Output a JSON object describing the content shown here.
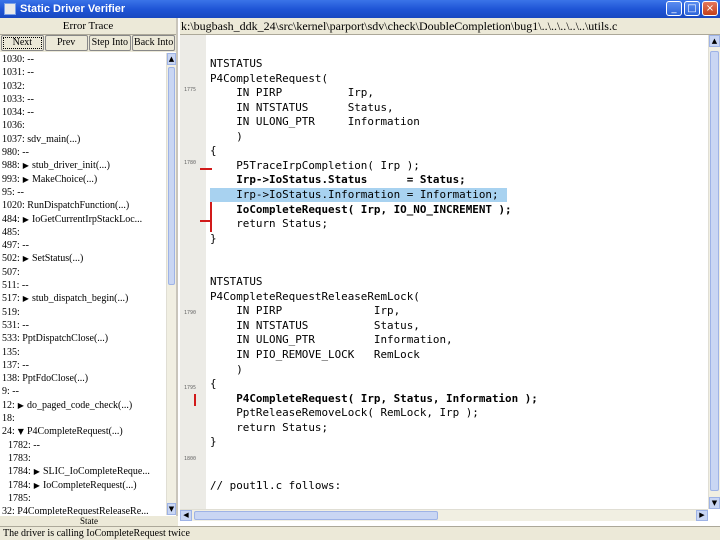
{
  "window": {
    "title": "Static Driver Verifier",
    "buttons": [
      "_",
      "□",
      "×"
    ]
  },
  "trace": {
    "header": "Error Trace",
    "buttons": [
      "Next",
      "Prev",
      "Step Into",
      "Back Into"
    ],
    "items": [
      {
        "text": "1030: --",
        "indent": 0,
        "arrow": ""
      },
      {
        "text": "1031: --",
        "indent": 0,
        "arrow": ""
      },
      {
        "text": "1032:",
        "indent": 0,
        "arrow": ""
      },
      {
        "text": "1033: --",
        "indent": 0,
        "arrow": ""
      },
      {
        "text": "1034: --",
        "indent": 0,
        "arrow": ""
      },
      {
        "text": "1036:",
        "indent": 0,
        "arrow": ""
      },
      {
        "text": "1037: sdv_main(...)",
        "indent": 0,
        "arrow": ""
      },
      {
        "text": "980: --",
        "indent": 0,
        "arrow": ""
      },
      {
        "text": "988:",
        "indent": 0,
        "arrow": "right",
        "call": "stub_driver_init(...)"
      },
      {
        "text": "993:",
        "indent": 0,
        "arrow": "right",
        "call": "MakeChoice(...)"
      },
      {
        "text": "95: --",
        "indent": 0,
        "arrow": ""
      },
      {
        "text": "1020: RunDispatchFunction(...)",
        "indent": 0,
        "arrow": ""
      },
      {
        "text": "484:",
        "indent": 0,
        "arrow": "right",
        "call": "IoGetCurrentIrpStackLoc..."
      },
      {
        "text": "485:",
        "indent": 0,
        "arrow": ""
      },
      {
        "text": "497: --",
        "indent": 0,
        "arrow": ""
      },
      {
        "text": "502:",
        "indent": 0,
        "arrow": "right",
        "call": "SetStatus(...)"
      },
      {
        "text": "507:",
        "indent": 0,
        "arrow": ""
      },
      {
        "text": "511: --",
        "indent": 0,
        "arrow": ""
      },
      {
        "text": "517:",
        "indent": 0,
        "arrow": "right",
        "call": "stub_dispatch_begin(...)"
      },
      {
        "text": "519:",
        "indent": 0,
        "arrow": ""
      },
      {
        "text": "531: --",
        "indent": 0,
        "arrow": ""
      },
      {
        "text": "533: PptDispatchClose(...)",
        "indent": 0,
        "arrow": ""
      },
      {
        "text": "135:",
        "indent": 0,
        "arrow": ""
      },
      {
        "text": "137: --",
        "indent": 0,
        "arrow": ""
      },
      {
        "text": "138: PptFdoClose(...)",
        "indent": 0,
        "arrow": ""
      },
      {
        "text": "9: --",
        "indent": 0,
        "arrow": ""
      },
      {
        "text": "12:",
        "indent": 0,
        "arrow": "right",
        "call": "do_paged_code_check(...)"
      },
      {
        "text": "18:",
        "indent": 0,
        "arrow": ""
      },
      {
        "text": "24:",
        "indent": 0,
        "arrow": "down",
        "call": "P4CompleteRequest(...)"
      },
      {
        "text": "1782: --",
        "indent": 1,
        "arrow": ""
      },
      {
        "text": "1783:",
        "indent": 1,
        "arrow": ""
      },
      {
        "text": "1784:",
        "indent": 1,
        "arrow": "right",
        "call": "SLIC_IoCompleteReque..."
      },
      {
        "text": "1784:",
        "indent": 1,
        "arrow": "right",
        "call": "IoCompleteRequest(...)"
      },
      {
        "text": "1785:",
        "indent": 1,
        "arrow": ""
      },
      {
        "text": "32: P4CompleteRequestReleaseRe...",
        "indent": 0,
        "arrow": ""
      }
    ],
    "state_label": "State"
  },
  "source": {
    "path": "k:\\bugbash_ddk_24\\src\\kernel\\parport\\sdv\\check\\DoubleCompletion\\bug1\\..\\..\\..\\..\\..\\utils.c",
    "line_numbers": [
      "1775",
      "1780",
      "1790",
      "1795",
      "1800"
    ],
    "lines": [
      {
        "text": "NTSTATUS",
        "style": "normal"
      },
      {
        "text": "P4CompleteRequest(",
        "style": "normal"
      },
      {
        "text": "    IN PIRP          Irp,",
        "style": "normal"
      },
      {
        "text": "    IN NTSTATUS      Status,",
        "style": "normal"
      },
      {
        "text": "    IN ULONG_PTR     Information",
        "style": "normal"
      },
      {
        "text": "    )",
        "style": "normal"
      },
      {
        "text": "{",
        "style": "normal"
      },
      {
        "text": "    P5TraceIrpCompletion( Irp );",
        "style": "normal"
      },
      {
        "text": "    Irp->IoStatus.Status      = Status;",
        "style": "bold"
      },
      {
        "text": "    Irp->IoStatus.Information = Information;",
        "style": "highlight"
      },
      {
        "text": "    IoCompleteRequest( Irp, IO_NO_INCREMENT );",
        "style": "bold"
      },
      {
        "text": "    return Status;",
        "style": "normal"
      },
      {
        "text": "}",
        "style": "normal"
      },
      {
        "text": "",
        "style": "normal"
      },
      {
        "text": "",
        "style": "normal"
      },
      {
        "text": "NTSTATUS",
        "style": "normal"
      },
      {
        "text": "P4CompleteRequestReleaseRemLock(",
        "style": "normal"
      },
      {
        "text": "    IN PIRP              Irp,",
        "style": "normal"
      },
      {
        "text": "    IN NTSTATUS          Status,",
        "style": "normal"
      },
      {
        "text": "    IN ULONG_PTR         Information,",
        "style": "normal"
      },
      {
        "text": "    IN PIO_REMOVE_LOCK   RemLock",
        "style": "normal"
      },
      {
        "text": "    )",
        "style": "normal"
      },
      {
        "text": "{",
        "style": "normal"
      },
      {
        "text": "    P4CompleteRequest( Irp, Status, Information );",
        "style": "bold"
      },
      {
        "text": "    PptReleaseRemoveLock( RemLock, Irp );",
        "style": "normal"
      },
      {
        "text": "    return Status;",
        "style": "normal"
      },
      {
        "text": "}",
        "style": "normal"
      },
      {
        "text": "",
        "style": "normal"
      },
      {
        "text": "",
        "style": "normal"
      },
      {
        "text": "// pout1l.c follows:",
        "style": "normal"
      }
    ]
  },
  "status": {
    "text": "The driver is calling IoCompleteRequest twice"
  },
  "colors": {
    "highlight": "#a8d2f0",
    "marker": "#d11a1a",
    "titlebar": "#1f55d6"
  }
}
